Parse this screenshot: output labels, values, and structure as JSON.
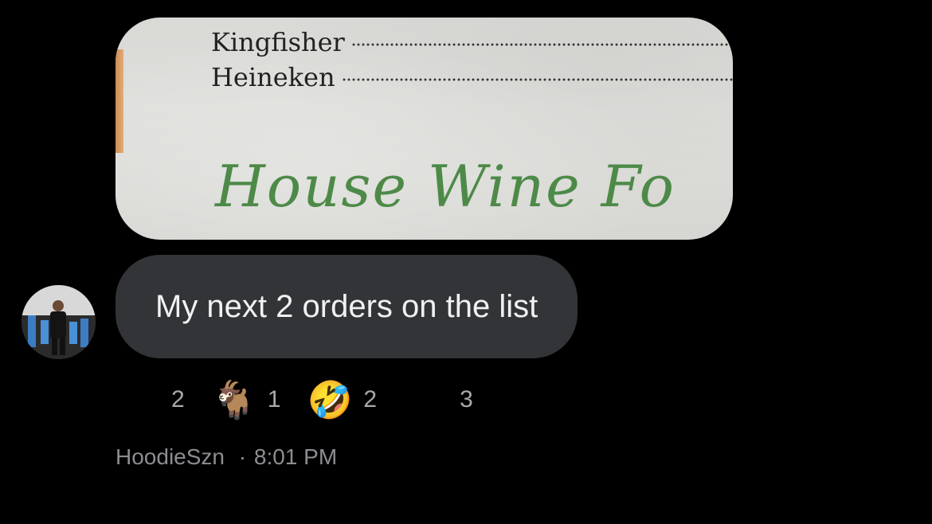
{
  "message": {
    "attachment": {
      "menu_lines": [
        {
          "item": "Kingfisher"
        },
        {
          "item": "Heineken"
        }
      ],
      "heading": "House Wine Fo"
    },
    "text": "My next 2 orders on the list",
    "sender": "HoodieSzn",
    "separator": "·",
    "time": "8:01 PM",
    "reactions": [
      {
        "emoji": "😂",
        "icon": "tears-of-joy-emoji",
        "count": "2"
      },
      {
        "emoji": "🐐",
        "icon": "goat-emoji",
        "count": "1"
      },
      {
        "emoji": "🤣",
        "icon": "rolling-laughing-emoji",
        "count": "2"
      },
      {
        "emoji": "😭",
        "icon": "crying-emoji",
        "count": "3"
      }
    ]
  },
  "colors": {
    "background": "#000000",
    "bubble": "#323437",
    "meta_text": "#8d8d92",
    "menu_heading": "#4d8a48"
  }
}
